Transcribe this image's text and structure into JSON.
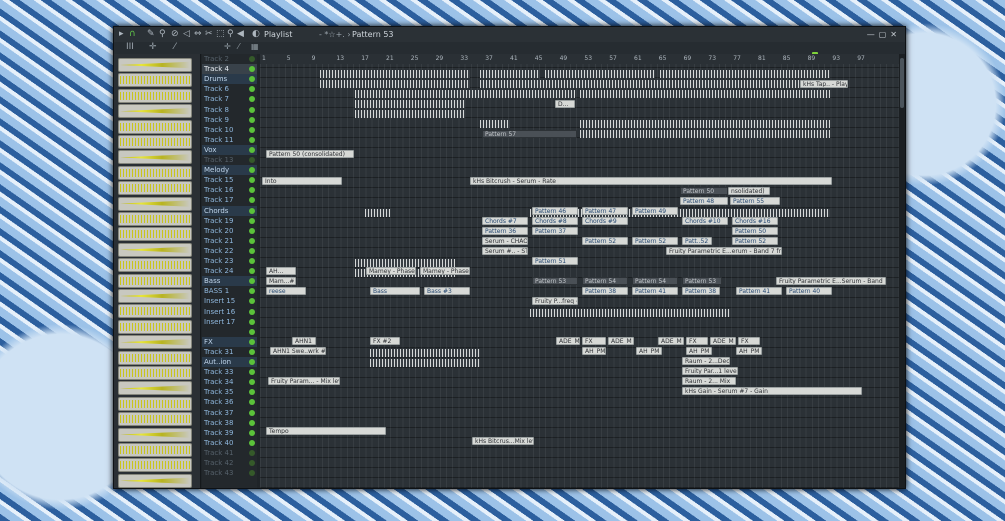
{
  "window": {
    "title": "Playlist",
    "crumb": "- *☆+.  ›",
    "pattern": "Pattern 53",
    "pattern_arrow": "›"
  },
  "ruler": [
    "1",
    "5",
    "9",
    "13",
    "17",
    "21",
    "25",
    "29",
    "33",
    "37",
    "41",
    "45",
    "49",
    "53",
    "57",
    "61",
    "65",
    "69",
    "73",
    "77",
    "81",
    "85",
    "89",
    "93",
    "97"
  ],
  "picker_header": {
    "a": "III",
    "b": "✛",
    "c": "⁄"
  },
  "tracks": [
    {
      "label": "Track 2",
      "kind": "dim"
    },
    {
      "label": "Track 4",
      "kind": "sel"
    },
    {
      "label": "Drums",
      "kind": "grp"
    },
    {
      "label": "Track 6",
      "kind": "n"
    },
    {
      "label": "Track 7",
      "kind": "n"
    },
    {
      "label": "Track 8",
      "kind": "n"
    },
    {
      "label": "Track 9",
      "kind": "n"
    },
    {
      "label": "Track 10",
      "kind": "n"
    },
    {
      "label": "Track 11",
      "kind": "n"
    },
    {
      "label": "Vox",
      "kind": "grp"
    },
    {
      "label": "Track 13",
      "kind": "dim"
    },
    {
      "label": "Melody",
      "kind": "grp"
    },
    {
      "label": "Track 15",
      "kind": "n"
    },
    {
      "label": "Track 16",
      "kind": "n"
    },
    {
      "label": "Track 17",
      "kind": "n"
    },
    {
      "label": "Chords",
      "kind": "grp"
    },
    {
      "label": "Track 19",
      "kind": "n"
    },
    {
      "label": "Track 20",
      "kind": "n"
    },
    {
      "label": "Track 21",
      "kind": "n"
    },
    {
      "label": "Track 22",
      "kind": "n"
    },
    {
      "label": "Track 23",
      "kind": "n"
    },
    {
      "label": "Track 24",
      "kind": "n"
    },
    {
      "label": "Bass",
      "kind": "grp"
    },
    {
      "label": "BASS 1",
      "kind": "n"
    },
    {
      "label": "Insert 15",
      "kind": "n"
    },
    {
      "label": "Insert 16",
      "kind": "n"
    },
    {
      "label": "Insert 17",
      "kind": "n"
    },
    {
      "label": "",
      "kind": "n"
    },
    {
      "label": "FX",
      "kind": "grp"
    },
    {
      "label": "Track 31",
      "kind": "n"
    },
    {
      "label": "Aut..ion",
      "kind": "grp"
    },
    {
      "label": "Track 33",
      "kind": "n"
    },
    {
      "label": "Track 34",
      "kind": "n"
    },
    {
      "label": "Track 35",
      "kind": "n"
    },
    {
      "label": "Track 36",
      "kind": "n"
    },
    {
      "label": "Track 37",
      "kind": "n"
    },
    {
      "label": "Track 38",
      "kind": "n"
    },
    {
      "label": "Track 39",
      "kind": "n"
    },
    {
      "label": "Track 40",
      "kind": "n"
    },
    {
      "label": "Track 41",
      "kind": "dim"
    },
    {
      "label": "Track 42",
      "kind": "dim"
    },
    {
      "label": "Track 43",
      "kind": "dim"
    }
  ],
  "clips": {
    "p50": "Pattern 50 (consolidated)",
    "khs_tap": "kHs Tap.. - Play",
    "d": "D...",
    "p57": "Pattern 57",
    "into": "Into",
    "khs_bit": "kHs Bitcrush - Serum - Rate",
    "p50b": "Pattern 50",
    "p48": "Pattern 48",
    "cons": "nsolidated)",
    "p55": "Pattern 55",
    "p46": "Pattern 46",
    "p47": "Pattern 47",
    "p49": "Pattern 49",
    "ch7": "Chords #7",
    "ch8": "Chords #8",
    "ch9": "Chords #9",
    "ch10": "Chords #10",
    "ch16": "Chords #16",
    "p36": "Pattern 36",
    "p37": "Pattern 37",
    "p50c": "Pattern 50",
    "serum_chao": "Serum - CHAO",
    "p52a": "Pattern 52",
    "p52b": "Pattern 52",
    "patt52": "Patt..52",
    "p52c": "Pattern 52",
    "serum_stn": "Serum #.. - STN",
    "frp": "Fruity Parametric E...erum - Band 7 freq",
    "p51": "Pattern 51",
    "ah": "AH...",
    "mamey1": "Mamey - Phase",
    "mamey2": "Mamey - Phase",
    "mam": "Mam...#2",
    "p53": "Pattern 53",
    "p54a": "Pattern 54",
    "p54b": "Pattern 54",
    "p53b": "Pattern 53",
    "reese": "reese",
    "bass": "Bass",
    "bass3": "Bass #3",
    "p38a": "Pattern 38",
    "p41a": "Pattern 41",
    "p38b": "Pattern 38",
    "p41b": "Pattern 41",
    "p40": "Pattern 40",
    "frp2": "Fruity Parametric E...Serum - Band 7 freq",
    "frp3": "Fruity P...freq #4",
    "ahn": "AHN1",
    "fx2": "FX #2",
    "ahn1": "AHN1 Swe..wrk #2",
    "ade1": "ADE_M",
    "fxa": "FX",
    "ade2": "ADE_M",
    "ade3": "ADE_M",
    "fxb": "FX",
    "ade4": "ADE_M",
    "fxc": "FX",
    "ahpm1": "AH_PM",
    "ahpm2": "AH_PM",
    "ahpm3": "AH_PM",
    "ahpm4": "AH_PM",
    "raum1": "Raum - 2...Decay",
    "frpl": "Fruity Par...1 level",
    "raum2": "Raum - 2... Mix",
    "khs_gain": "kHs Gain - Serum #7 - Gain",
    "frpm": "Fruity Param... - Mix level",
    "tempo": "Tempo",
    "khs_mix": "kHs Bitcrus...Mix level"
  },
  "colors": {
    "panel": "#1f2428",
    "accent": "#7fd33a",
    "clip": "#d7d9d6"
  }
}
